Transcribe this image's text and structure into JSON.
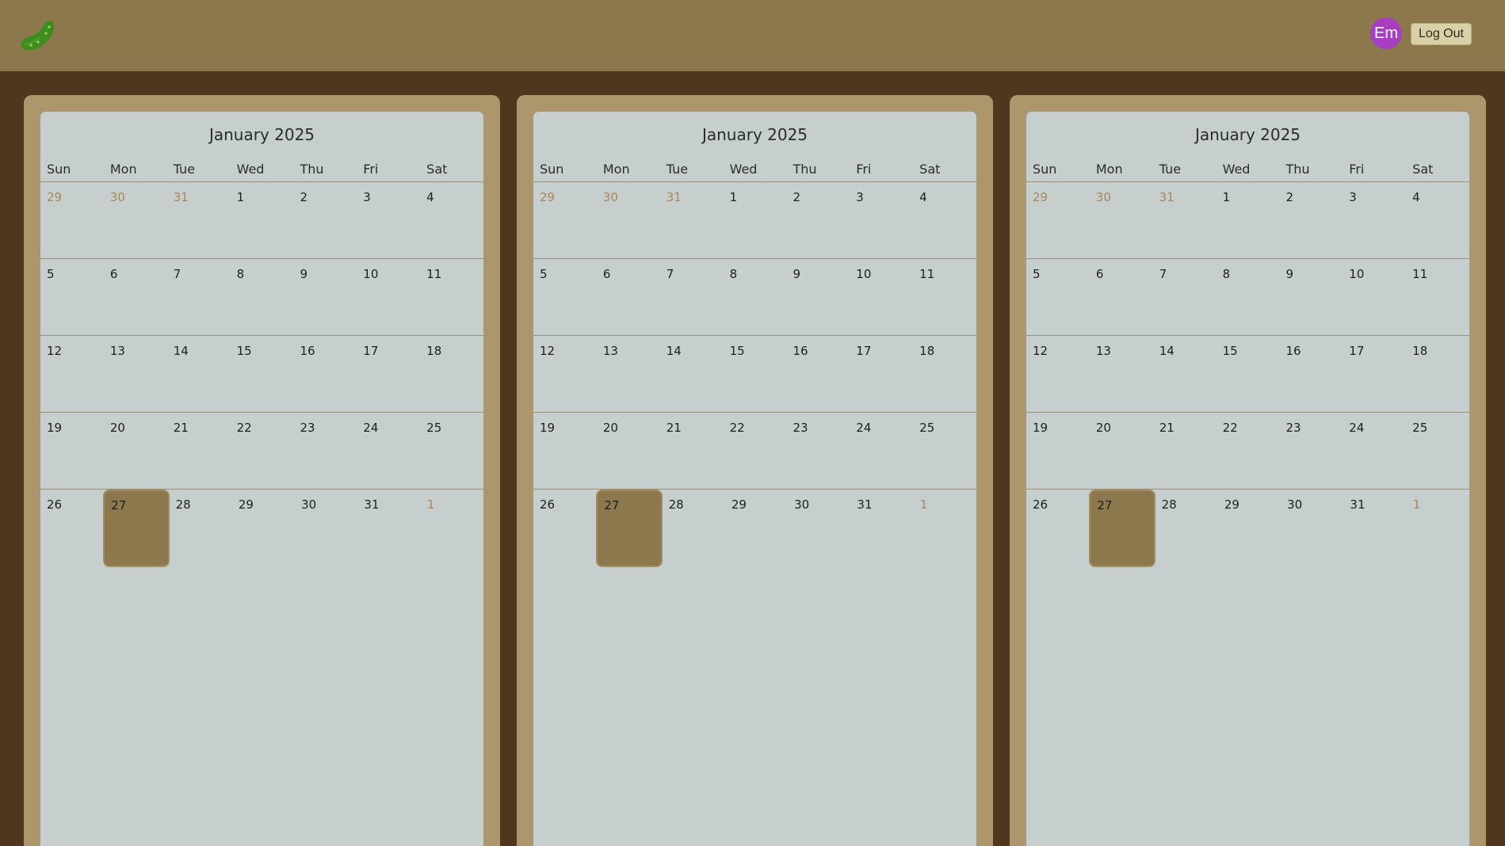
{
  "header": {
    "logo_icon": "pickle-icon",
    "avatar_initials": "Em",
    "logout_label": "Log Out"
  },
  "colors": {
    "topbar": "#8c784c",
    "background": "#4f361c",
    "panel": "#ae966c",
    "calendar": "#c7cfce",
    "today": "#8c784c",
    "other_month_text": "#a8865a",
    "avatar": "#a73fc1"
  },
  "calendars": [
    {
      "title": "January 2025",
      "weekdays": [
        "Sun",
        "Mon",
        "Tue",
        "Wed",
        "Thu",
        "Fri",
        "Sat"
      ],
      "weeks": [
        [
          "29",
          "30",
          "31",
          "1",
          "2",
          "3",
          "4"
        ],
        [
          "5",
          "6",
          "7",
          "8",
          "9",
          "10",
          "11"
        ],
        [
          "12",
          "13",
          "14",
          "15",
          "16",
          "17",
          "18"
        ],
        [
          "19",
          "20",
          "21",
          "22",
          "23",
          "24",
          "25"
        ],
        [
          "26",
          "27",
          "28",
          "29",
          "30",
          "31",
          "1"
        ]
      ],
      "today": "27"
    },
    {
      "title": "January 2025",
      "weekdays": [
        "Sun",
        "Mon",
        "Tue",
        "Wed",
        "Thu",
        "Fri",
        "Sat"
      ],
      "weeks": [
        [
          "29",
          "30",
          "31",
          "1",
          "2",
          "3",
          "4"
        ],
        [
          "5",
          "6",
          "7",
          "8",
          "9",
          "10",
          "11"
        ],
        [
          "12",
          "13",
          "14",
          "15",
          "16",
          "17",
          "18"
        ],
        [
          "19",
          "20",
          "21",
          "22",
          "23",
          "24",
          "25"
        ],
        [
          "26",
          "27",
          "28",
          "29",
          "30",
          "31",
          "1"
        ]
      ],
      "today": "27"
    },
    {
      "title": "January 2025",
      "weekdays": [
        "Sun",
        "Mon",
        "Tue",
        "Wed",
        "Thu",
        "Fri",
        "Sat"
      ],
      "weeks": [
        [
          "29",
          "30",
          "31",
          "1",
          "2",
          "3",
          "4"
        ],
        [
          "5",
          "6",
          "7",
          "8",
          "9",
          "10",
          "11"
        ],
        [
          "12",
          "13",
          "14",
          "15",
          "16",
          "17",
          "18"
        ],
        [
          "19",
          "20",
          "21",
          "22",
          "23",
          "24",
          "25"
        ],
        [
          "26",
          "27",
          "28",
          "29",
          "30",
          "31",
          "1"
        ]
      ],
      "today": "27"
    }
  ]
}
